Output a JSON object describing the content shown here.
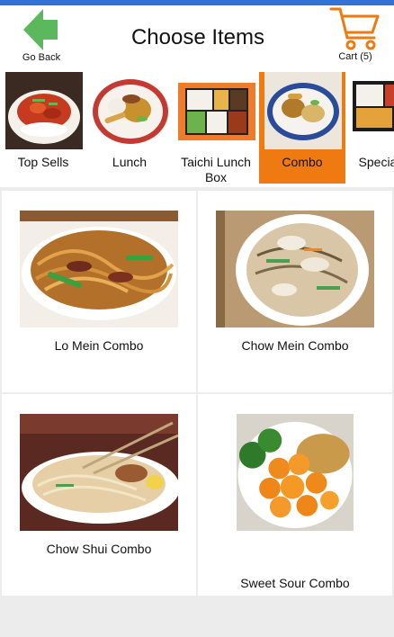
{
  "header": {
    "back_label": "Go Back",
    "title": "Choose Items",
    "cart_label": "Cart (5)",
    "back_icon": "arrow-left-icon",
    "cart_icon": "shopping-cart-icon"
  },
  "categories": [
    {
      "label": "Top Sells",
      "selected": false
    },
    {
      "label": "Lunch",
      "selected": false
    },
    {
      "label": "Taichi Lunch Box",
      "selected": false
    },
    {
      "label": "Combo",
      "selected": true
    },
    {
      "label": "Special Bo",
      "selected": false
    }
  ],
  "items": [
    {
      "name": "Lo Mein Combo"
    },
    {
      "name": "Chow Mein Combo"
    },
    {
      "name": "Chow Shui Combo"
    },
    {
      "name": "Sweet Sour Combo"
    }
  ],
  "colors": {
    "accent": "#f07a12",
    "back_icon": "#5cb85c",
    "status_bar": "#2f73d8"
  }
}
